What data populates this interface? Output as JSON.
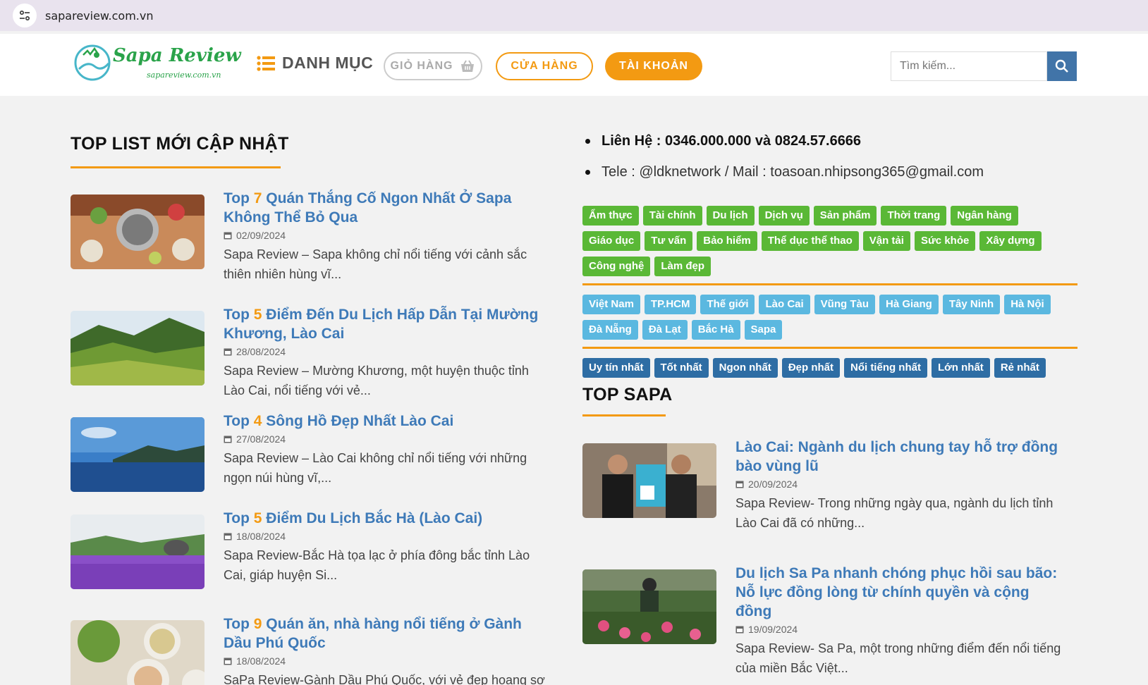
{
  "browser": {
    "url": "sapareview.com.vn"
  },
  "header": {
    "logo_text": "Sapa Review",
    "logo_sub": "sapareview.com.vn",
    "menu_label": "DANH MỤC",
    "cart_label": "GIỎ HÀNG",
    "shop_label": "CỬA HÀNG",
    "account_label": "TÀI KHOẢN",
    "search_placeholder": "Tìm kiếm..."
  },
  "left": {
    "title": "TOP LIST MỚI CẬP NHẬT",
    "posts": [
      {
        "prefix": "Top ",
        "num": "7",
        "title": " Quán Thắng Cố Ngon Nhất Ở Sapa Không Thể Bỏ Qua",
        "date": "02/09/2024",
        "excerpt": "Sapa Review – Sapa không chỉ nổi tiếng với cảnh sắc thiên nhiên hùng vĩ..."
      },
      {
        "prefix": "Top ",
        "num": "5",
        "title": " Điểm Đến Du Lịch Hấp Dẫn Tại Mường Khương, Lào Cai",
        "date": "28/08/2024",
        "excerpt": "Sapa Review – Mường Khương, một huyện thuộc tỉnh Lào Cai, nổi tiếng với vẻ..."
      },
      {
        "prefix": "Top ",
        "num": "4",
        "title": " Sông Hồ Đẹp Nhất Lào Cai",
        "date": "27/08/2024",
        "excerpt": "Sapa Review – Lào Cai không chỉ nổi tiếng với những ngọn núi hùng vĩ,..."
      },
      {
        "prefix": "Top ",
        "num": "5",
        "title": " Điểm Du Lịch Bắc Hà (Lào Cai)",
        "date": "18/08/2024",
        "excerpt": "Sapa Review-Bắc Hà tọa lạc ở phía đông bắc tỉnh Lào Cai, giáp huyện Si..."
      },
      {
        "prefix": "Top ",
        "num": "9",
        "title": " Quán ăn, nhà hàng nổi tiếng ở Gành Dầu Phú Quốc",
        "date": "18/08/2024",
        "excerpt": "SaPa Review-Gành Dầu Phú Quốc, với vẻ đẹp hoang sơ"
      }
    ]
  },
  "right": {
    "contact_phone": "Liên Hệ  : 0346.000.000 và 0824.57.6666",
    "contact_tele": "Tele : @ldknetwork / Mail : toasoan.nhipsong365@gmail.com",
    "tags_topics": [
      "Ẩm thực",
      "Tài chính",
      "Du lịch",
      "Dịch vụ",
      "Sản phẩm",
      "Thời trang",
      "Ngân hàng",
      "Giáo dục",
      "Tư vấn",
      "Bảo hiểm",
      "Thể dục thể thao",
      "Vận tải",
      "Sức khỏe",
      "Xây dựng",
      "Công nghệ",
      "Làm đẹp"
    ],
    "tags_places": [
      "Việt Nam",
      "TP.HCM",
      "Thế giới",
      "Lào Cai",
      "Vũng Tàu",
      "Hà Giang",
      "Tây Ninh",
      "Hà Nội",
      "Đà Nẵng",
      "Đà Lạt",
      "Bắc Hà",
      "Sapa"
    ],
    "tags_superlatives": [
      "Uy tín nhất",
      "Tốt nhất",
      "Ngon nhất",
      "Đẹp nhất",
      "Nổi tiếng nhất",
      "Lớn nhất",
      "Rẻ nhất"
    ],
    "top_title": "TOP SAPA",
    "posts": [
      {
        "title": "Lào Cai: Ngành du lịch chung tay hỗ trợ đồng bào vùng lũ",
        "date": "20/09/2024",
        "excerpt": "Sapa Review- Trong những ngày qua, ngành du lịch tỉnh Lào Cai đã có những..."
      },
      {
        "title": "Du lịch Sa Pa nhanh chóng phục hồi sau bão: Nỗ lực đồng lòng từ chính quyền và cộng đồng",
        "date": "19/09/2024",
        "excerpt": "Sapa Review- Sa Pa, một trong những điểm đến nổi tiếng của miền Bắc Việt..."
      }
    ]
  },
  "colors": {
    "accent": "#f39a12",
    "link": "#3e7ab8",
    "tag_green": "#5ab836",
    "tag_teal": "#5bb8e0",
    "tag_blue": "#2e6da4"
  }
}
